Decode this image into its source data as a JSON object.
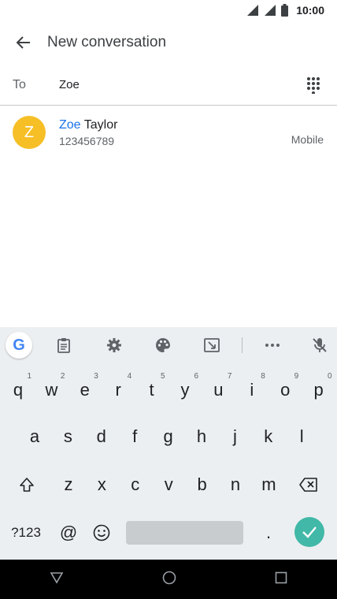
{
  "status": {
    "time": "10:00"
  },
  "appbar": {
    "title": "New conversation"
  },
  "to": {
    "label": "To",
    "value": "Zoe"
  },
  "contact": {
    "initial": "Z",
    "name_match": "Zoe",
    "name_rest": " Taylor",
    "number": "123456789",
    "type": "Mobile"
  },
  "keyboard": {
    "row1": [
      {
        "k": "q",
        "h": "1"
      },
      {
        "k": "w",
        "h": "2"
      },
      {
        "k": "e",
        "h": "3"
      },
      {
        "k": "r",
        "h": "4"
      },
      {
        "k": "t",
        "h": "5"
      },
      {
        "k": "y",
        "h": "6"
      },
      {
        "k": "u",
        "h": "7"
      },
      {
        "k": "i",
        "h": "8"
      },
      {
        "k": "o",
        "h": "9"
      },
      {
        "k": "p",
        "h": "0"
      }
    ],
    "row2": [
      "a",
      "s",
      "d",
      "f",
      "g",
      "h",
      "j",
      "k",
      "l"
    ],
    "row3": [
      "z",
      "x",
      "c",
      "v",
      "b",
      "n",
      "m"
    ],
    "symbols_label": "?123",
    "at_label": "@",
    "period_label": ".",
    "google_label": "G",
    "accent_color": "#41b8a8",
    "toolbar_icons": [
      "google-icon",
      "clipboard-icon",
      "settings-icon",
      "palette-icon",
      "translate-icon",
      "more-icon",
      "mic-off-icon"
    ]
  }
}
